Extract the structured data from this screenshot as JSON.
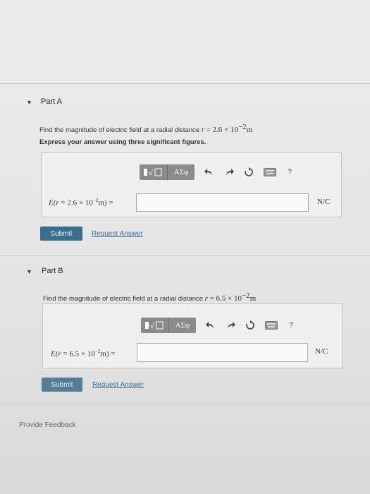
{
  "part_a": {
    "title": "Part A",
    "question_prefix": "Find the magnitude of electric field at a radial distance",
    "question_var": "r",
    "question_eq": "=",
    "question_val": "2.6 × 10",
    "question_exp": "−2",
    "question_unit": "m",
    "instruction": "Express your answer using three significant figures.",
    "label_prefix": "E(",
    "label_var": "r",
    "label_eq": " = 2.6 × 10",
    "label_exp": "−2",
    "label_suffix": "m) =",
    "input_value": "",
    "units": "N/C",
    "submit": "Submit",
    "request": "Request Answer"
  },
  "part_b": {
    "title": "Part B",
    "question_prefix": "Find the magnitude of electric field at a radial distance",
    "question_var": "r",
    "question_eq": "=",
    "question_val": "6.5 × 10",
    "question_exp": "−2",
    "question_unit": "m",
    "label_prefix": "E(",
    "label_var": "r",
    "label_eq": " = 6.5 × 10",
    "label_exp": "−2",
    "label_suffix": "m) =",
    "input_value": "",
    "units": "N/C",
    "submit": "Submit",
    "request": "Request Answer"
  },
  "toolbar": {
    "greek": "ΑΣφ",
    "help": "?",
    "icons": [
      "templates-icon",
      "greek-symbols-icon",
      "undo-icon",
      "redo-icon",
      "reset-icon",
      "keyboard-icon",
      "help-icon"
    ]
  },
  "feedback": "Provide Feedback"
}
